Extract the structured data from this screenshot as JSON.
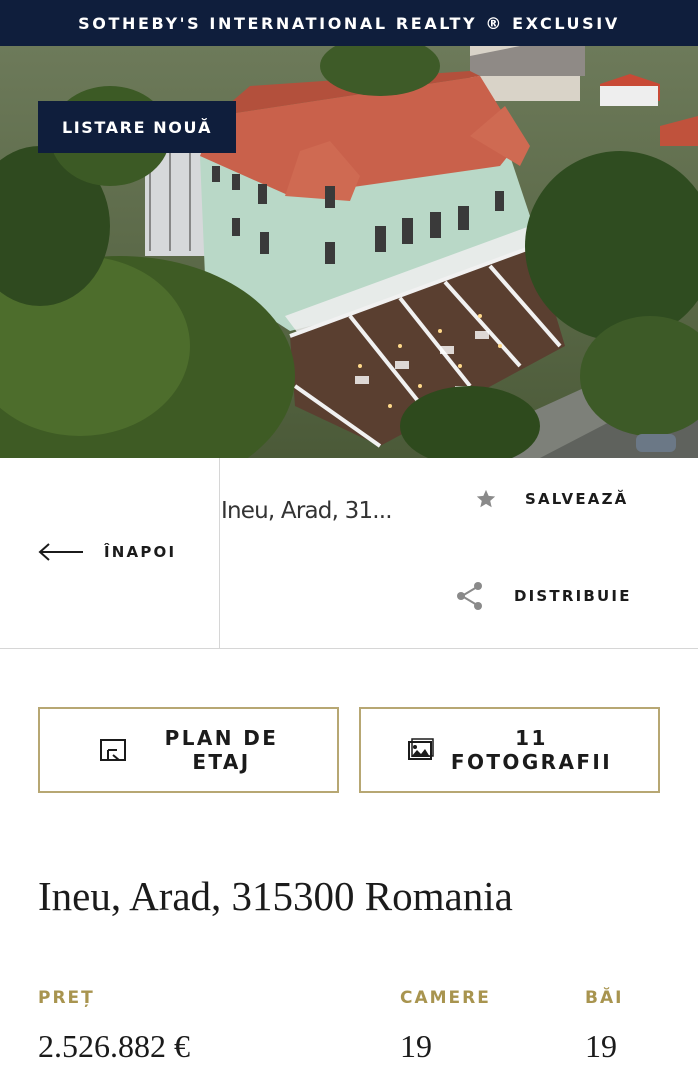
{
  "header": {
    "brand": "SOTHEBY'S INTERNATIONAL REALTY ® EXCLUSIV"
  },
  "hero": {
    "badge": "LISTARE NOUĂ",
    "image": "aerial-photo-building-with-terrace"
  },
  "nav": {
    "back_label": "ÎNAPOI",
    "address_short": "Ineu, Arad, 31...",
    "save_label": "SALVEAZĂ",
    "share_label": "DISTRIBUIE"
  },
  "buttons": {
    "floorplan_line1": "PLAN DE",
    "floorplan_line2": "ETAJ",
    "photos_line1": "11",
    "photos_line2": "FOTOGRAFII"
  },
  "listing": {
    "address": "Ineu, Arad, 315300 Romania",
    "price_label": "PREȚ",
    "price_value": "2.526.882 €",
    "rooms_label": "CAMERE",
    "rooms_value": "19",
    "baths_label": "BĂI",
    "baths_value": "19"
  },
  "colors": {
    "navy": "#0f1e3c",
    "gold": "#a8944f",
    "border_gold": "#b7a773"
  }
}
